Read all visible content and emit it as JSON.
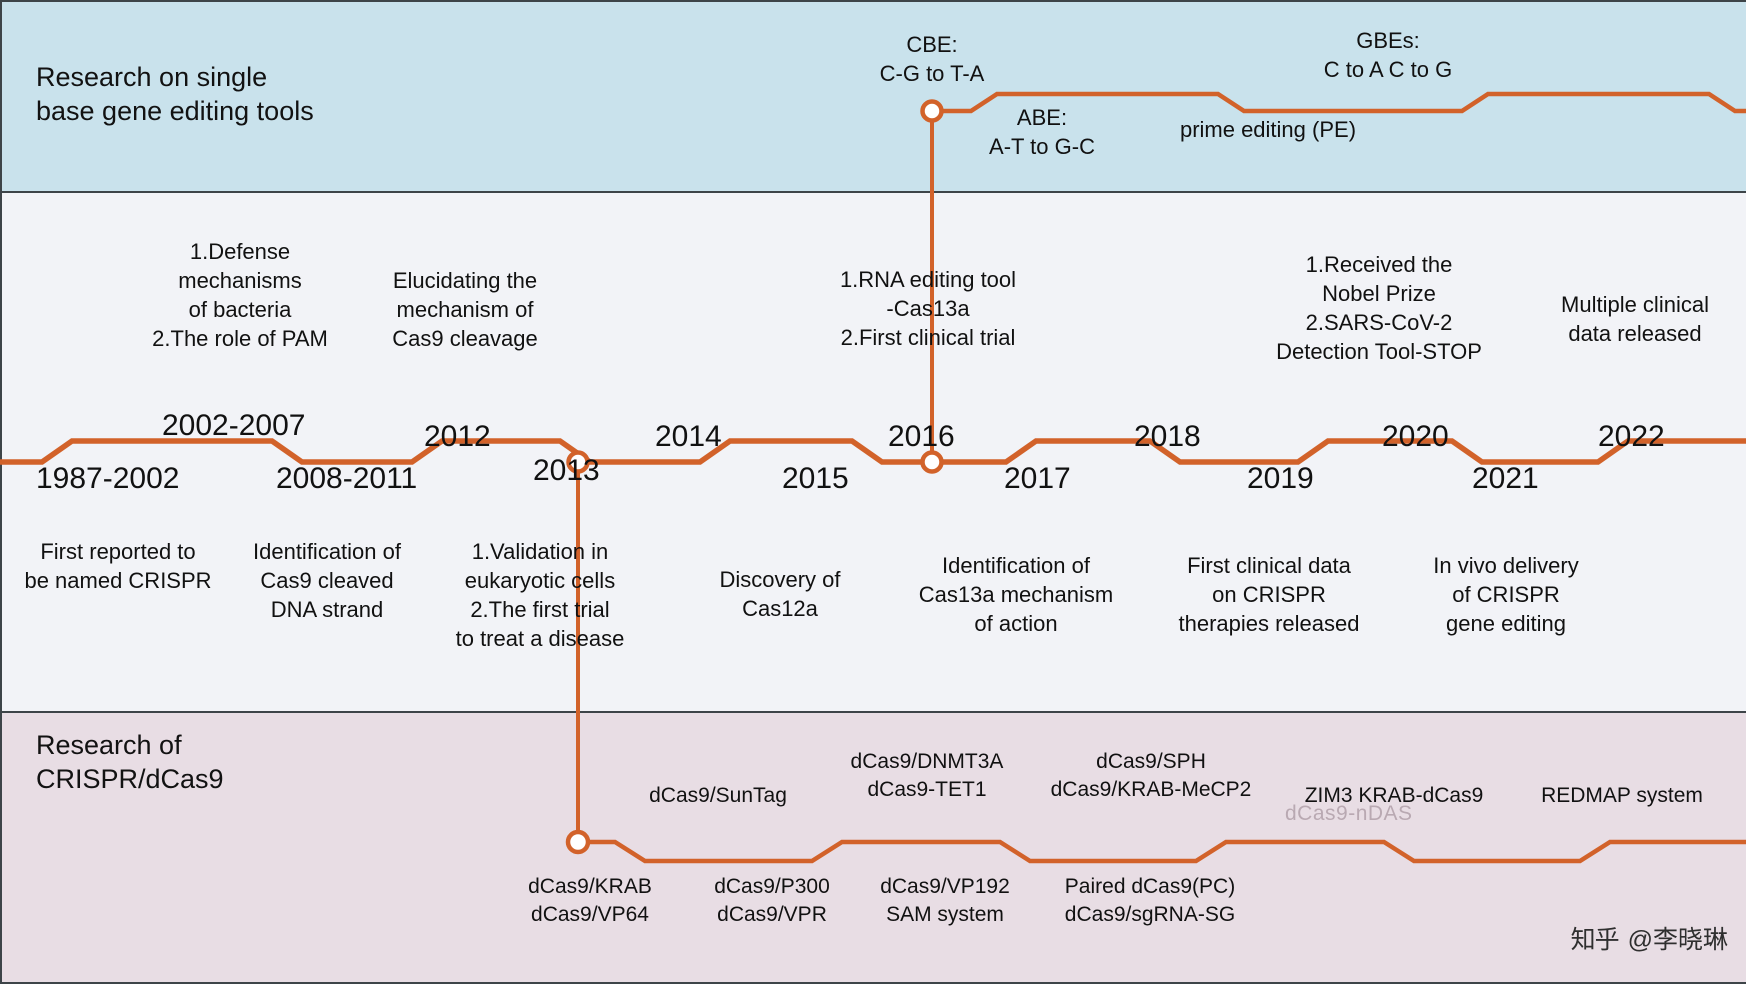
{
  "meta": {
    "accent_color": "#d2622a",
    "top_band_color": "#c9e2ec",
    "mid_band_color": "#f2f3f7",
    "bottom_band_color": "#e8dde4"
  },
  "top_panel": {
    "title": "Research on single\nbase gene editing tools",
    "labels": [
      {
        "text": "CBE:\nC-G to T-A"
      },
      {
        "text": "ABE:\nA-T to G-C"
      },
      {
        "text": "prime editing (PE)"
      },
      {
        "text": "GBEs:\nC to A  C to G"
      }
    ]
  },
  "middle_panel": {
    "above_timeline": [
      {
        "text": "1.Defense\nmechanisms\nof bacteria\n2.The role of PAM"
      },
      {
        "text": "Elucidating the\nmechanism of\nCas9 cleavage"
      },
      {
        "text": "1.RNA editing tool\n-Cas13a\n2.First clinical trial"
      },
      {
        "text": "1.Received the\nNobel Prize\n2.SARS-CoV-2\nDetection Tool-STOP"
      },
      {
        "text": "Multiple clinical\ndata released"
      }
    ],
    "years_above": [
      "2002-2007",
      "2012",
      "2014",
      "2016",
      "2018",
      "2020",
      "2022"
    ],
    "years_below": [
      "1987-2002",
      "2008-2011",
      "2013",
      "2015",
      "2017",
      "2019",
      "2021"
    ],
    "below_timeline": [
      {
        "text": "First reported to\nbe named CRISPR"
      },
      {
        "text": "Identification of\nCas9 cleaved\nDNA strand"
      },
      {
        "text": "1.Validation in\neukaryotic cells\n2.The first trial\nto treat a disease"
      },
      {
        "text": "Discovery of\nCas12a"
      },
      {
        "text": "Identification of\nCas13a mechanism\nof action"
      },
      {
        "text": "First clinical data\non CRISPR\ntherapies released"
      },
      {
        "text": "In vivo delivery\nof CRISPR\ngene editing"
      }
    ]
  },
  "bottom_panel": {
    "title": "Research of\nCRISPR/dCas9",
    "above_line": [
      {
        "text": "dCas9/SunTag"
      },
      {
        "text": "dCas9/DNMT3A\ndCas9-TET1"
      },
      {
        "text": "dCas9/SPH\ndCas9/KRAB-MeCP2"
      },
      {
        "text": "ZIM3 KRAB-dCas9"
      },
      {
        "text": "REDMAP system"
      }
    ],
    "below_line": [
      {
        "text": "dCas9/KRAB\ndCas9/VP64"
      },
      {
        "text": "dCas9/P300\ndCas9/VPR"
      },
      {
        "text": "dCas9/VP192\nSAM system"
      },
      {
        "text": "Paired dCas9(PC)\ndCas9/sgRNA-SG"
      },
      {
        "text": "dCas9-nDAS"
      }
    ]
  },
  "watermark": {
    "logo": "知乎",
    "text": "@李晓琳"
  }
}
